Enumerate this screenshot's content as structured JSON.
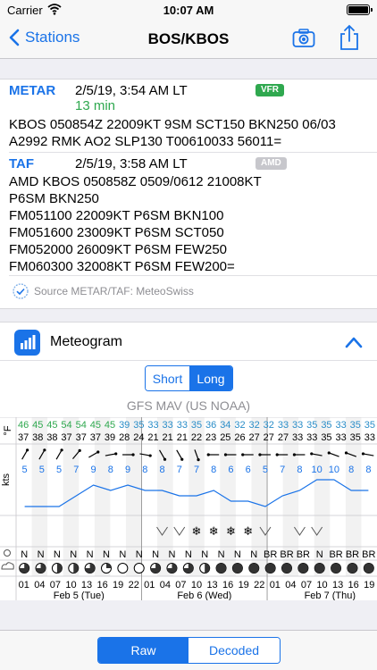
{
  "status": {
    "carrier": "Carrier",
    "time": "10:07 AM"
  },
  "nav": {
    "back_label": "Stations",
    "title": "BOS/KBOS"
  },
  "metar": {
    "label": "METAR",
    "date": "2/5/19, 3:54 AM LT",
    "age": "13 min",
    "badge": "VFR",
    "badge_color": "#2fa84f",
    "text": "KBOS 050854Z 22009KT 9SM SCT150 BKN250 06/03\nA2992 RMK AO2 SLP130 T00610033 56011="
  },
  "taf": {
    "label": "TAF",
    "date": "2/5/19, 3:58 AM LT",
    "badge": "AMD",
    "badge_color": "#c7c7cc",
    "text": "AMD KBOS 050858Z 0509/0612 21008KT\nP6SM BKN250\nFM051100 22009KT P6SM BKN100\nFM051600 23009KT P6SM SCT050\nFM052000 26009KT P6SM FEW250\nFM060300 32008KT P6SM FEW200="
  },
  "source": "Source METAR/TAF: MeteoSwiss",
  "meteogram": {
    "title": "Meteogram",
    "toggle": {
      "short": "Short",
      "long": "Long",
      "selected": "Long"
    },
    "model": "GFS MAV (US NOAA)",
    "temp_unit": "°F",
    "wind_unit": "kts",
    "temps_high": [
      46,
      45,
      45,
      54,
      54,
      45,
      45,
      39,
      35,
      33,
      33,
      33,
      35,
      36,
      34,
      32,
      32,
      32,
      33,
      33,
      35,
      35,
      33,
      35,
      35
    ],
    "temps_low": [
      37,
      38,
      38,
      37,
      37,
      37,
      39,
      28,
      24,
      21,
      21,
      21,
      22,
      23,
      25,
      26,
      27,
      27,
      27,
      33,
      33,
      35,
      33,
      35,
      33
    ],
    "wind_speed": [
      5,
      5,
      5,
      7,
      9,
      8,
      9,
      8,
      8,
      7,
      7,
      8,
      6,
      6,
      5,
      7,
      8,
      10,
      10,
      8,
      8
    ],
    "wind_dir_deg": [
      210,
      210,
      210,
      220,
      240,
      260,
      270,
      280,
      330,
      330,
      340,
      90,
      90,
      90,
      90,
      90,
      90,
      100,
      110,
      110,
      100
    ],
    "weather": [
      "",
      "",
      "",
      "",
      "",
      "",
      "",
      "",
      "wind",
      "wind",
      "snow",
      "snow",
      "snow",
      "snow",
      "wind",
      "",
      "wind",
      "wind",
      "",
      "",
      ""
    ],
    "visibility": [
      "N",
      "N",
      "N",
      "N",
      "N",
      "N",
      "N",
      "N",
      "N",
      "N",
      "N",
      "N",
      "N",
      "N",
      "N",
      "BR",
      "BR",
      "BR",
      "N",
      "BR",
      "BR",
      "BR"
    ],
    "cloud_cover": [
      3,
      3,
      2,
      2,
      3,
      1,
      0,
      0,
      3,
      3,
      3,
      2,
      4,
      4,
      4,
      4,
      4,
      4,
      4,
      4,
      4,
      4
    ],
    "hours": [
      "01",
      "04",
      "07",
      "10",
      "13",
      "16",
      "19",
      "22",
      "01",
      "04",
      "07",
      "10",
      "13",
      "16",
      "19",
      "22",
      "01",
      "04",
      "07",
      "10",
      "13",
      "16",
      "19"
    ],
    "days": [
      "Feb 5 (Tue)",
      "Feb 6 (Wed)",
      "Feb 7 (Thu)"
    ],
    "accent_color": "#1a73e8"
  },
  "bottom_toggle": {
    "raw": "Raw",
    "decoded": "Decoded",
    "selected": "Raw"
  }
}
